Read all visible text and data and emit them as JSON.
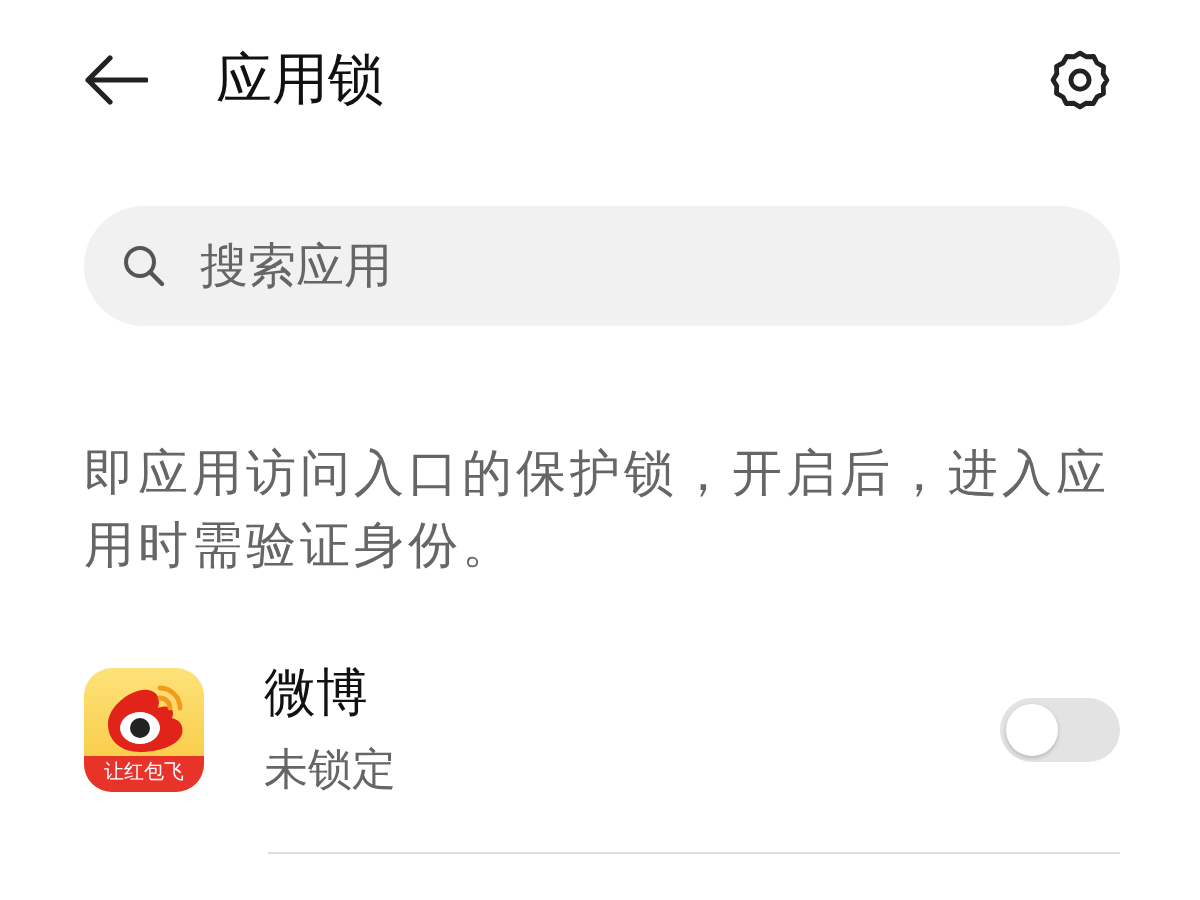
{
  "header": {
    "title": "应用锁"
  },
  "search": {
    "placeholder": "搜索应用"
  },
  "description": "即应用访问入口的保护锁，开启后，进入应用时需验证身份。",
  "apps": [
    {
      "name": "微博",
      "status": "未锁定",
      "icon_text": "让红包飞",
      "on": false
    }
  ]
}
